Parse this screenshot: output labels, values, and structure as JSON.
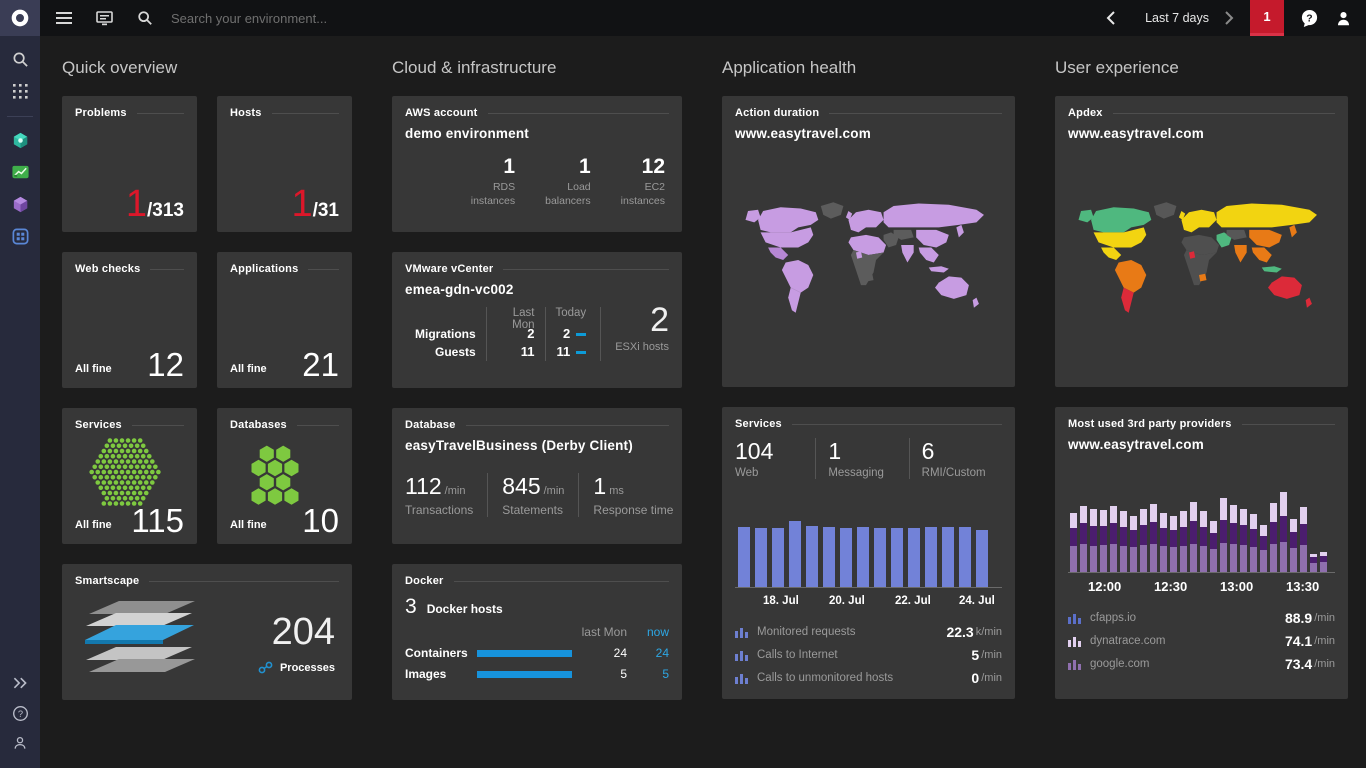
{
  "topbar": {
    "search_placeholder": "Search your environment...",
    "timeframe": "Last 7 days",
    "notification_count": "1"
  },
  "icons": [
    "dynatrace-logo",
    "hamburger-menu-icon",
    "dashboards-icon",
    "search-icon",
    "chevron-left-icon",
    "chevron-right-icon",
    "chat-icon",
    "user-icon",
    "apps-grid-icon",
    "hosts-icon",
    "applications-icon",
    "services-icon",
    "smartscape-icon",
    "expand-icon",
    "help-icon",
    "account-icon",
    "process-link-icon"
  ],
  "quick": {
    "title": "Quick overview",
    "problems": {
      "label": "Problems",
      "value": "1",
      "total": "/313"
    },
    "hosts": {
      "label": "Hosts",
      "value": "1",
      "total": "/31"
    },
    "webchecks": {
      "label": "Web checks",
      "status": "All fine",
      "value": "12"
    },
    "applications": {
      "label": "Applications",
      "status": "All fine",
      "value": "21"
    },
    "services": {
      "label": "Services",
      "status": "All fine",
      "value": "115"
    },
    "databases": {
      "label": "Databases",
      "status": "All fine",
      "value": "10"
    },
    "smartscape": {
      "label": "Smartscape",
      "value": "204",
      "unit": "Processes"
    }
  },
  "cloud": {
    "title": "Cloud & infrastructure",
    "aws": {
      "label": "AWS account",
      "name": "demo environment",
      "stats": [
        {
          "value": "1",
          "label": "RDS\ninstances"
        },
        {
          "value": "1",
          "label": "Load\nbalancers"
        },
        {
          "value": "12",
          "label": "EC2\ninstances"
        }
      ]
    },
    "vmware": {
      "label": "VMware vCenter",
      "name": "emea-gdn-vc002",
      "col1": "Last Mon",
      "col2": "Today",
      "rows": [
        {
          "label": "Migrations",
          "last": "2",
          "today": "2"
        },
        {
          "label": "Guests",
          "last": "11",
          "today": "11"
        }
      ],
      "esxi_value": "2",
      "esxi_label": "ESXi hosts"
    },
    "database": {
      "label": "Database",
      "name": "easyTravelBusiness (Derby Client)",
      "stats": [
        {
          "value": "112",
          "unit": "/min",
          "label": "Transactions"
        },
        {
          "value": "845",
          "unit": "/min",
          "label": "Statements"
        },
        {
          "value": "1",
          "unit": "ms",
          "label": "Response time"
        }
      ]
    },
    "docker": {
      "label": "Docker",
      "hosts_value": "3",
      "hosts_label": "Docker hosts",
      "col1": "last Mon",
      "col2": "now",
      "rows": [
        {
          "label": "Containers",
          "last": "24",
          "now": "24"
        },
        {
          "label": "Images",
          "last": "5",
          "now": "5"
        }
      ]
    }
  },
  "apphealth": {
    "title": "Application health",
    "action_duration": {
      "label": "Action duration",
      "name": "www.easytravel.com"
    },
    "services": {
      "label": "Services",
      "stats": [
        {
          "value": "104",
          "label": "Web"
        },
        {
          "value": "1",
          "label": "Messaging"
        },
        {
          "value": "6",
          "label": "RMI/Custom"
        }
      ],
      "legend": [
        {
          "label": "Monitored requests",
          "value": "22.3",
          "unit": "k/min"
        },
        {
          "label": "Calls to Internet",
          "value": "5",
          "unit": "/min"
        },
        {
          "label": "Calls to unmonitored hosts",
          "value": "0",
          "unit": "/min"
        }
      ]
    }
  },
  "ux": {
    "title": "User experience",
    "apdex": {
      "label": "Apdex",
      "name": "www.easytravel.com"
    },
    "providers": {
      "label": "Most used 3rd party providers",
      "name": "www.easytravel.com",
      "legend": [
        {
          "label": "cfapps.io",
          "value": "88.9",
          "unit": "/min"
        },
        {
          "label": "dynatrace.com",
          "value": "74.1",
          "unit": "/min"
        },
        {
          "label": "google.com",
          "value": "73.4",
          "unit": "/min"
        }
      ]
    }
  },
  "chart_data": [
    {
      "type": "bar",
      "title": "Service requests over last 7 days",
      "x_tick_labels": [
        "18. Jul",
        "20. Jul",
        "22. Jul",
        "24. Jul"
      ],
      "values": [
        22.2,
        22.1,
        22.0,
        24.4,
        22.7,
        22.2,
        22.1,
        22.2,
        22.1,
        22.0,
        22.1,
        22.2,
        22.3,
        22.2,
        21.4
      ],
      "unit": "k/min",
      "color": "#7282d8",
      "ylim": [
        0,
        32
      ]
    },
    {
      "type": "bar",
      "subtype": "stacked",
      "title": "Most used 3rd party providers",
      "x_tick_labels": [
        "12:00",
        "12:30",
        "13:00",
        "13:30"
      ],
      "series": [
        {
          "name": "google.com",
          "color": "#8f6fae",
          "values": [
            28,
            30,
            28,
            29,
            30,
            28,
            27,
            29,
            30,
            28,
            27,
            28,
            30,
            28,
            25,
            31,
            30,
            29,
            27,
            24,
            30,
            33,
            26,
            29,
            10,
            11
          ]
        },
        {
          "name": "cfapps.io",
          "color": "#4b1d6e",
          "values": [
            20,
            23,
            22,
            21,
            23,
            21,
            19,
            22,
            24,
            20,
            19,
            21,
            25,
            21,
            17,
            26,
            23,
            22,
            20,
            15,
            24,
            28,
            18,
            23,
            6,
            6
          ]
        },
        {
          "name": "dynatrace.com",
          "color": "#e2d0ef",
          "values": [
            16,
            19,
            18,
            17,
            19,
            17,
            15,
            18,
            20,
            16,
            15,
            17,
            21,
            17,
            13,
            23,
            20,
            18,
            16,
            12,
            21,
            26,
            14,
            19,
            4,
            5
          ]
        }
      ],
      "unit": "/min",
      "ylim": [
        0,
        100
      ]
    }
  ],
  "maps": {
    "action_duration": {
      "regions": {
        "alaska": "#c79ce2",
        "canada": "#c79ce2",
        "usa": "#c79ce2",
        "mexico": "#b687d4",
        "greenland": "#5c5c5c",
        "south_america_n": "#c79ce2",
        "south_america_s": "#c79ce2",
        "europe": "#c79ce2",
        "uk": "#c79ce2",
        "africa_n": "#c79ce2",
        "africa_s": "#5c5c5c",
        "africa_patch1": "#c79ce2",
        "africa_patch2": "#5c5c5c",
        "middle_east": "#5c5c5c",
        "russia": "#c79ce2",
        "central_asia": "#5c5c5c",
        "china": "#c79ce2",
        "india": "#c79ce2",
        "se_asia": "#c79ce2",
        "indonesia": "#c79ce2",
        "japan": "#c79ce2",
        "australia": "#c79ce2",
        "new_zealand": "#c79ce2"
      }
    },
    "apdex": {
      "regions": {
        "alaska": "#4fb87f",
        "canada": "#4fb87f",
        "usa": "#f2d411",
        "mexico": "#f2d411",
        "greenland": "#575757",
        "south_america_n": "#e87a16",
        "south_america_s": "#dc2a39",
        "europe": "#f2d411",
        "uk": "#f2d411",
        "africa_n": "#4f4f4f",
        "africa_s": "#4f4f4f",
        "africa_patch1": "#dc2a39",
        "africa_patch2": "#e87a16",
        "middle_east": "#4fb87f",
        "russia": "#f2d411",
        "central_asia": "#575757",
        "china": "#e87a16",
        "india": "#e87a16",
        "se_asia": "#e87a16",
        "indonesia": "#4fb87f",
        "japan": "#e87a16",
        "australia": "#dc2a39",
        "new_zealand": "#dc2a39"
      }
    }
  },
  "colors": {
    "accent_red": "#dc172a",
    "accent_blue": "#14a8f5",
    "green": "#7ec940",
    "bar_blue": "#7282d8",
    "tile_bg": "#373737"
  }
}
